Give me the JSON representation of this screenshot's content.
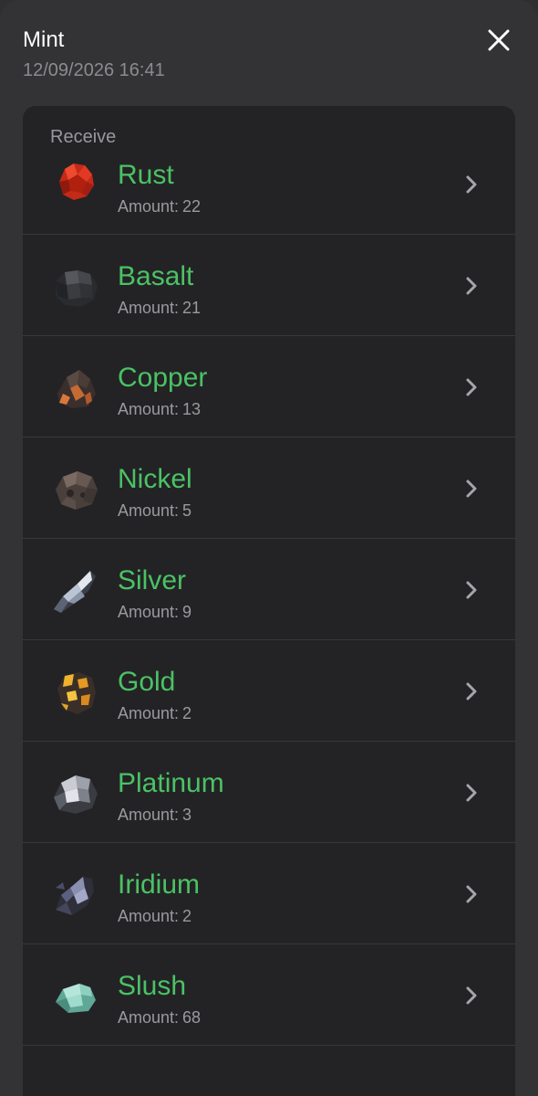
{
  "header": {
    "title": "Mint",
    "date": "12/09/2026 16:41",
    "close_icon": "close-icon"
  },
  "section": {
    "label": "Receive",
    "amount_prefix": "Amount:"
  },
  "items": [
    {
      "name": "Rust",
      "amount": "22",
      "icon": "rust-ore-icon",
      "color": "#d8331d"
    },
    {
      "name": "Basalt",
      "amount": "21",
      "icon": "basalt-ore-icon",
      "color": "#3c3d40"
    },
    {
      "name": "Copper",
      "amount": "13",
      "icon": "copper-ore-icon",
      "color": "#b4582c"
    },
    {
      "name": "Nickel",
      "amount": "5",
      "icon": "nickel-ore-icon",
      "color": "#6b5a50"
    },
    {
      "name": "Silver",
      "amount": "9",
      "icon": "silver-ore-icon",
      "color": "#9aa6b8"
    },
    {
      "name": "Gold",
      "amount": "2",
      "icon": "gold-ore-icon",
      "color": "#e3a12a"
    },
    {
      "name": "Platinum",
      "amount": "3",
      "icon": "platinum-ore-icon",
      "color": "#a9adb5"
    },
    {
      "name": "Iridium",
      "amount": "2",
      "icon": "iridium-ore-icon",
      "color": "#6a6f8a"
    },
    {
      "name": "Slush",
      "amount": "68",
      "icon": "slush-ore-icon",
      "color": "#86cbbb"
    }
  ],
  "colors": {
    "accent_green": "#4bc264",
    "background": "#333335",
    "card": "#232326"
  }
}
